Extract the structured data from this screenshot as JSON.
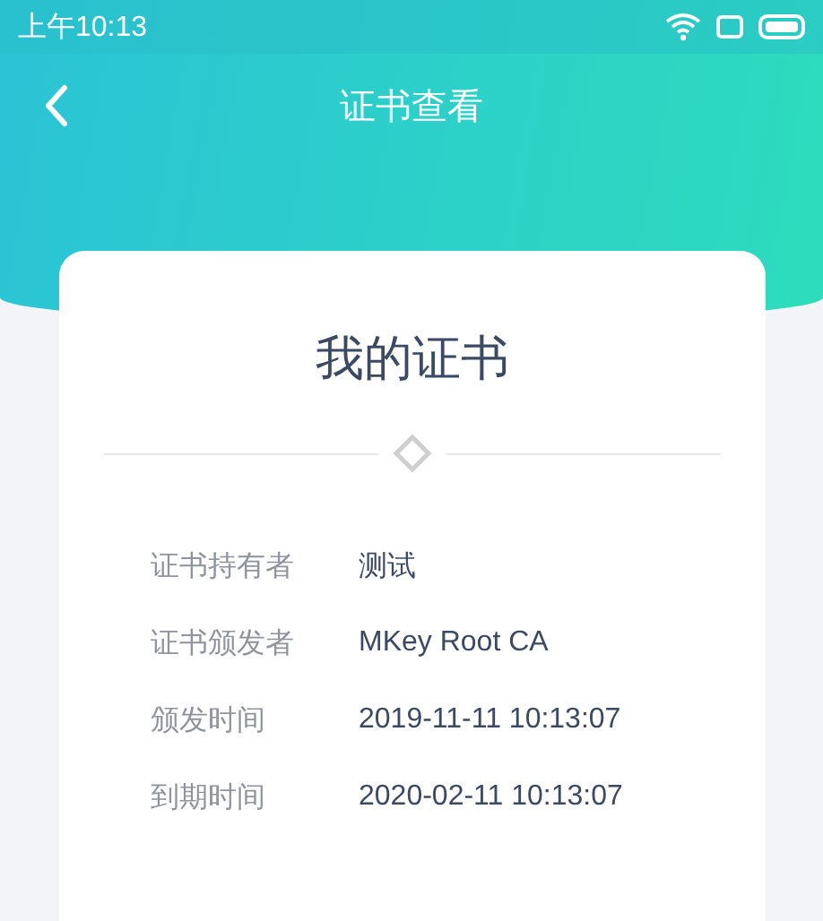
{
  "status_bar": {
    "time": "上午10:13"
  },
  "header": {
    "title": "证书查看"
  },
  "card": {
    "title": "我的证书",
    "rows": [
      {
        "label": "证书持有者",
        "value": "测试"
      },
      {
        "label": "证书颁发者",
        "value": "MKey Root CA"
      },
      {
        "label": "颁发时间",
        "value": "2019-11-11 10:13:07"
      },
      {
        "label": "到期时间",
        "value": "2020-02-11 10:13:07"
      }
    ]
  }
}
